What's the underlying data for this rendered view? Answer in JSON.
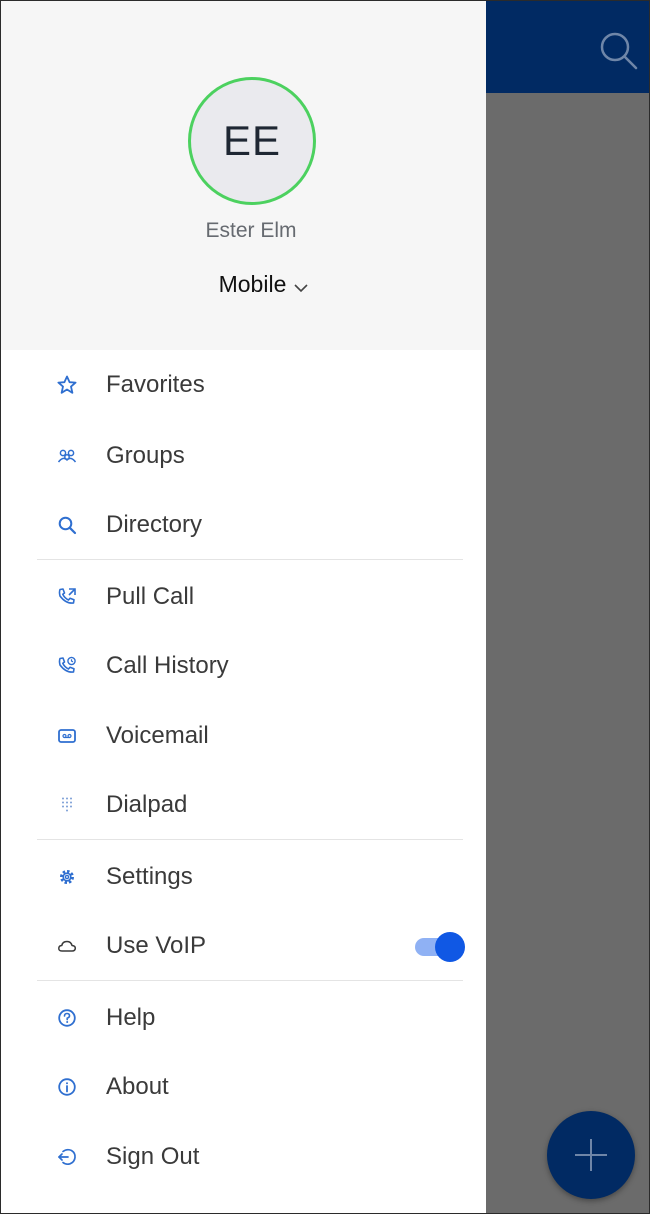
{
  "profile": {
    "initials": "EE",
    "name": "Ester Elm",
    "line": "Mobile"
  },
  "menu": {
    "favorites": "Favorites",
    "groups": "Groups",
    "directory": "Directory",
    "pull_call": "Pull Call",
    "call_history": "Call History",
    "voicemail": "Voicemail",
    "dialpad": "Dialpad",
    "settings": "Settings",
    "use_voip": "Use VoIP",
    "help": "Help",
    "about": "About",
    "sign_out": "Sign Out"
  },
  "voip_enabled": true,
  "colors": {
    "brand_navy": "#012a63",
    "accent_blue": "#1058e4",
    "avatar_ring": "#4cd15f",
    "icon_blue": "#2f6fd0"
  },
  "icons": {
    "favorites": "star-icon",
    "groups": "groups-icon",
    "directory": "search-icon",
    "pull_call": "pull-call-icon",
    "call_history": "call-history-icon",
    "voicemail": "voicemail-icon",
    "dialpad": "dialpad-icon",
    "settings": "gear-icon",
    "use_voip": "cloud-icon",
    "help": "help-icon",
    "about": "info-icon",
    "sign_out": "sign-out-icon"
  }
}
